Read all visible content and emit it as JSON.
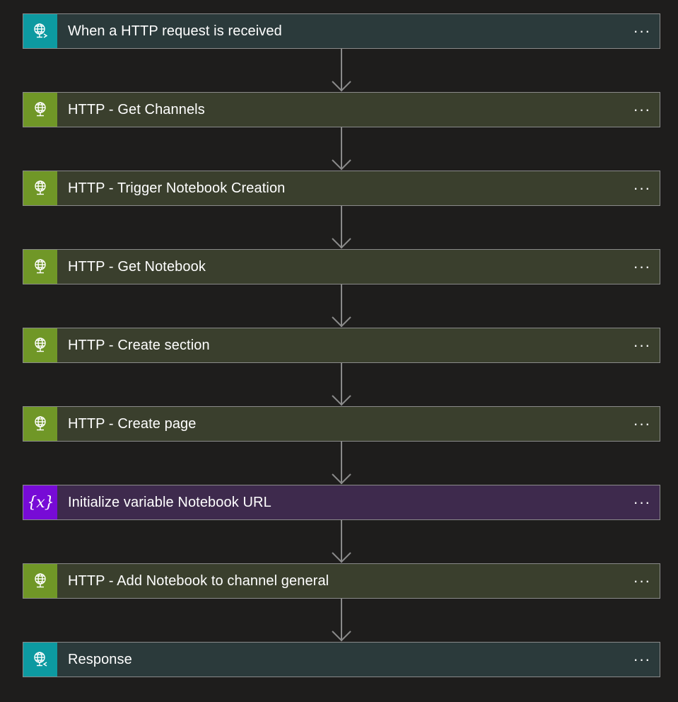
{
  "flow": {
    "steps": [
      {
        "label": "When a HTTP request is received",
        "kind": "trigger",
        "icon": "http-request-globe-icon",
        "color": "#0d9aa1"
      },
      {
        "label": "HTTP - Get Channels",
        "kind": "http",
        "icon": "http-globe-icon",
        "color": "#709727"
      },
      {
        "label": "HTTP - Trigger Notebook Creation",
        "kind": "http",
        "icon": "http-globe-icon",
        "color": "#709727"
      },
      {
        "label": "HTTP - Get Notebook",
        "kind": "http",
        "icon": "http-globe-icon",
        "color": "#709727"
      },
      {
        "label": "HTTP - Create section",
        "kind": "http",
        "icon": "http-globe-icon",
        "color": "#709727"
      },
      {
        "label": "HTTP - Create page",
        "kind": "http",
        "icon": "http-globe-icon",
        "color": "#709727"
      },
      {
        "label": "Initialize variable Notebook URL",
        "kind": "variable",
        "icon": "variable-braces-icon",
        "color": "#770bd6"
      },
      {
        "label": "HTTP - Add Notebook to channel general",
        "kind": "http",
        "icon": "http-globe-icon",
        "color": "#709727"
      },
      {
        "label": "Response",
        "kind": "response",
        "icon": "http-response-globe-icon",
        "color": "#0d9aa1"
      }
    ],
    "more_label": "···",
    "variable_glyph": "{x}"
  }
}
